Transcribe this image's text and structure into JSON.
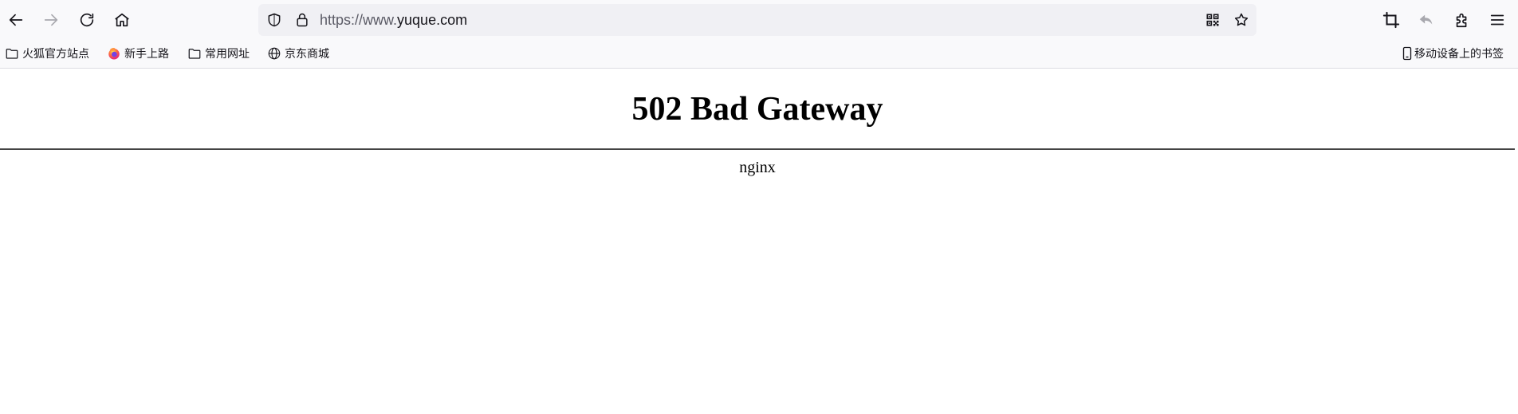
{
  "toolbar": {
    "back_icon": "arrow-left-icon",
    "forward_icon": "arrow-right-icon",
    "reload_icon": "reload-icon",
    "home_icon": "home-icon",
    "url_scheme_prefix": "https://www.",
    "url_host": "yuque.com",
    "right_icons": [
      "screenshot-crop-icon",
      "undo-icon",
      "extensions-icon",
      "menu-icon"
    ]
  },
  "bookmarks": {
    "items": [
      {
        "label": "火狐官方站点",
        "icon": "folder-icon"
      },
      {
        "label": "新手上路",
        "icon": "firefox-icon"
      },
      {
        "label": "常用网址",
        "icon": "folder-icon"
      },
      {
        "label": "京东商城",
        "icon": "globe-icon"
      }
    ],
    "mobile_label": "移动设备上的书签"
  },
  "page": {
    "heading": "502 Bad Gateway",
    "server": "nginx"
  },
  "colors": {
    "toolbar_bg": "#f9f9fb",
    "urlbar_bg": "#f0f0f4",
    "text": "#15141a",
    "disabled": "#a8a8ae"
  }
}
